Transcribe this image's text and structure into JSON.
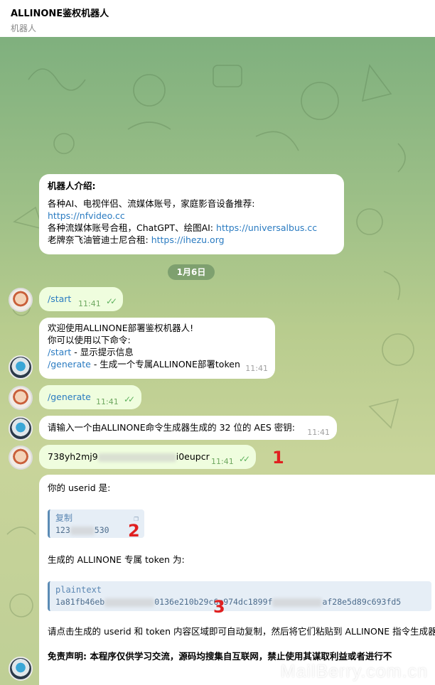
{
  "header": {
    "title": "ALLINONE鉴权机器人",
    "subtitle": "机器人"
  },
  "intro": {
    "heading": "机器人介绍:",
    "line1": "各种AI、电视伴侣、流媒体账号，家庭影音设备推荐:",
    "link1": "https://nfvideo.cc",
    "line2_text": "各种流媒体账号合租，ChatGPT、绘图AI:",
    "link2": "https://universalbus.cc",
    "line3_text": "老牌奈飞油管迪士尼合租:",
    "link3": "https://ihezu.org"
  },
  "date_separator": "1月6日",
  "messages": {
    "start_cmd": "/start",
    "start_time": "11:41",
    "welcome_line1": "欢迎使用ALLINONE部署鉴权机器人!",
    "welcome_line2": "你可以使用以下命令:",
    "welcome_cmd1": "/start",
    "welcome_cmd1_desc": " - 显示提示信息",
    "welcome_cmd2": "/generate",
    "welcome_cmd2_desc": " - 生成一个专属ALLINONE部署token",
    "welcome_time": "11:41",
    "generate_cmd": "/generate",
    "generate_time": "11:41",
    "prompt_text": "请输入一个由ALLINONE命令生成器生成的 32 位的 AES 密钥:",
    "prompt_time": "11:41",
    "key_start": "738yh2mj9",
    "key_end": "i0eupcr",
    "key_time": "11:41",
    "userid_label": "你的 userid 是:",
    "copy_label": "复制",
    "userid_start": "123",
    "userid_end": "530",
    "token_label": "生成的 ALLINONE 专属 token 为:",
    "code_lang": "plaintext",
    "token_part1": "1a81fb46eb",
    "token_part2": "0136e210b29c",
    "token_part3": "6c974dc1899f",
    "token_part4": "af28e5d89c693fd5",
    "instruction": "请点击生成的 userid 和 token 内容区域即可自动复制，然后将它们粘贴到 ALLINONE 指令生成器",
    "disclaimer": "免责声明: 本程序仅供学习交流，源码均搜集自互联网，禁止使用其谋取利益或者进行不"
  },
  "markers": [
    "1",
    "2",
    "3"
  ],
  "watermark": "MailBerry.com.cn",
  "colors": {
    "link": "#2a7bc1",
    "outgoing_bubble": "#effdde",
    "incoming_bubble": "#ffffff",
    "marker": "#e02020"
  }
}
